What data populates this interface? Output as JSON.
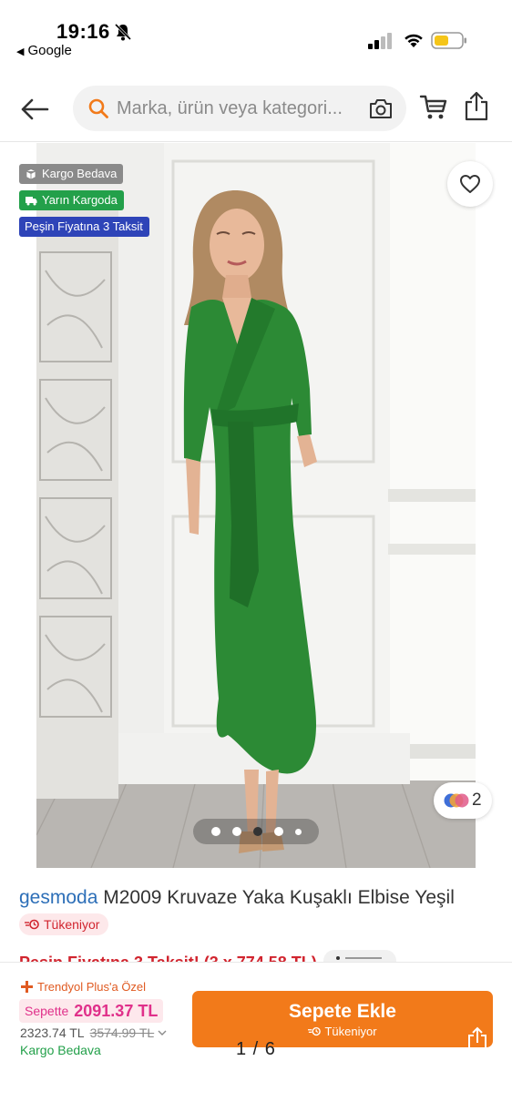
{
  "status_bar": {
    "time": "19:16",
    "back_app": "Google",
    "battery_color": "#f5c518"
  },
  "header": {
    "search_placeholder": "Marka, ürün veya kategori...",
    "icons": [
      "back-arrow-icon",
      "search-icon",
      "camera-icon",
      "cart-icon",
      "share-icon"
    ]
  },
  "product_image": {
    "badges": [
      {
        "label": "Kargo Bedava",
        "color": "#8a8a8a",
        "icon": "box-icon"
      },
      {
        "label": "Yarın Kargoda",
        "color": "#23a04a",
        "icon": "truck-icon"
      },
      {
        "label": "Peşin Fiyatına 3 Taksit",
        "color": "#2e44b8"
      }
    ],
    "color_count": "2",
    "pager": {
      "total_dots": 5,
      "active_index": 2
    }
  },
  "product": {
    "brand": "gesmoda",
    "title": "M2009 Kruvaze Yaka Kuşaklı Elbise Yeşil",
    "stock_badge": "Tükeniyor",
    "installment_text": "Peşin Fiyatına 3 Taksit! (3 x 774,58 TL)"
  },
  "bottom_bar": {
    "plus_label": "Trendyol Plus'a Özel",
    "sepette_label": "Sepette",
    "sepette_price": "2091.37 TL",
    "price": "2323.74 TL",
    "old_price": "3574.99 TL",
    "shipping": "Kargo Bedava",
    "add_to_cart": "Sepete Ekle",
    "add_to_cart_sub": "Tükeniyor",
    "accent_color": "#f27a1a"
  },
  "page_counter": "1 / 6"
}
